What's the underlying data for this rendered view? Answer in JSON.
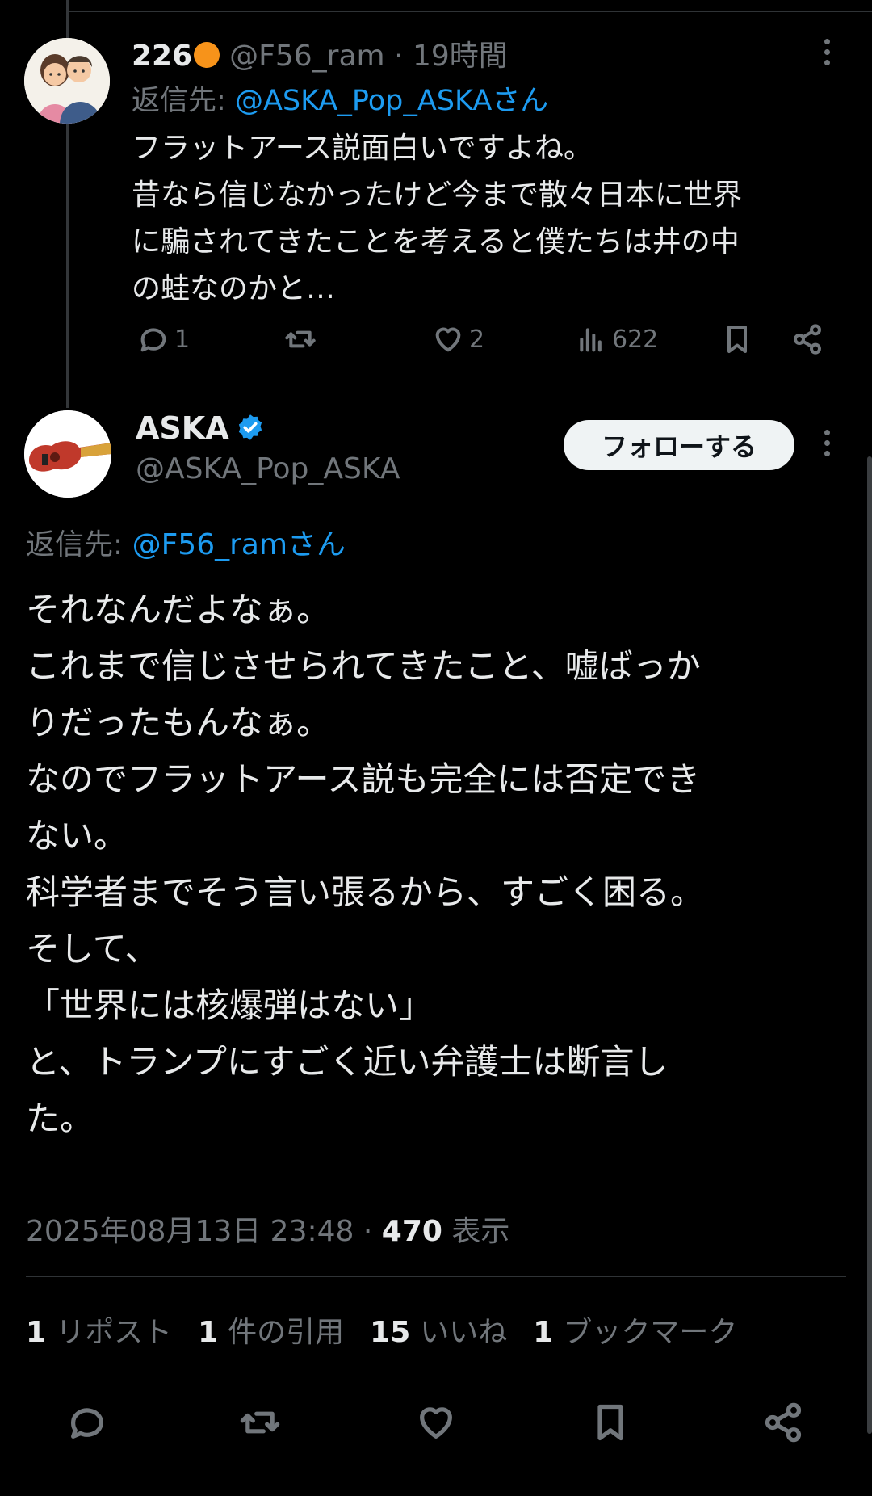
{
  "reply": {
    "display_name": "226",
    "handle": "@F56_ram",
    "time": "19時間",
    "reply_to_label": "返信先:",
    "reply_to_handle": "@ASKA_Pop_ASKAさん",
    "text_lines": [
      "フラットアース説面白いですよね。",
      "昔なら信じなかったけど今まで散々日本に世界",
      "に騙されてきたことを考えると僕たちは井の中",
      "の蛙なのかと…"
    ],
    "reply_count": "1",
    "like_count": "2",
    "view_count": "622"
  },
  "main": {
    "display_name": "ASKA",
    "handle": "@ASKA_Pop_ASKA",
    "follow_label": "フォローする",
    "reply_to_label": "返信先:",
    "reply_to_handle": "@F56_ramさん",
    "text_lines": [
      "それなんだよなぁ。",
      "これまで信じさせられてきたこと、嘘ばっか",
      "りだったもんなぁ。",
      "なのでフラットアース説も完全には否定でき",
      "ない。",
      "科学者までそう言い張るから、すごく困る。",
      "そして、",
      "「世界には核爆弾はない」",
      "と、トランプにすごく近い弁護士は断言し",
      "た。"
    ],
    "timestamp": "2025年08月13日 23:48",
    "dot": "·",
    "view_count": "470",
    "view_label": "表示",
    "stats": [
      {
        "count": "1",
        "label": "リポスト"
      },
      {
        "count": "1",
        "label": "件の引用"
      },
      {
        "count": "15",
        "label": "いいね"
      },
      {
        "count": "1",
        "label": "ブックマーク"
      }
    ]
  },
  "icons": {
    "reply": "reply-icon",
    "repost": "repost-icon",
    "like": "heart-icon",
    "views": "views-icon",
    "bookmark": "bookmark-icon",
    "share": "share-icon",
    "more": "more-icon",
    "verified": "verified-badge-icon"
  },
  "colors": {
    "link": "#1d9bf0",
    "muted": "#71767b",
    "text": "#e7e9ea",
    "background": "#000000"
  }
}
